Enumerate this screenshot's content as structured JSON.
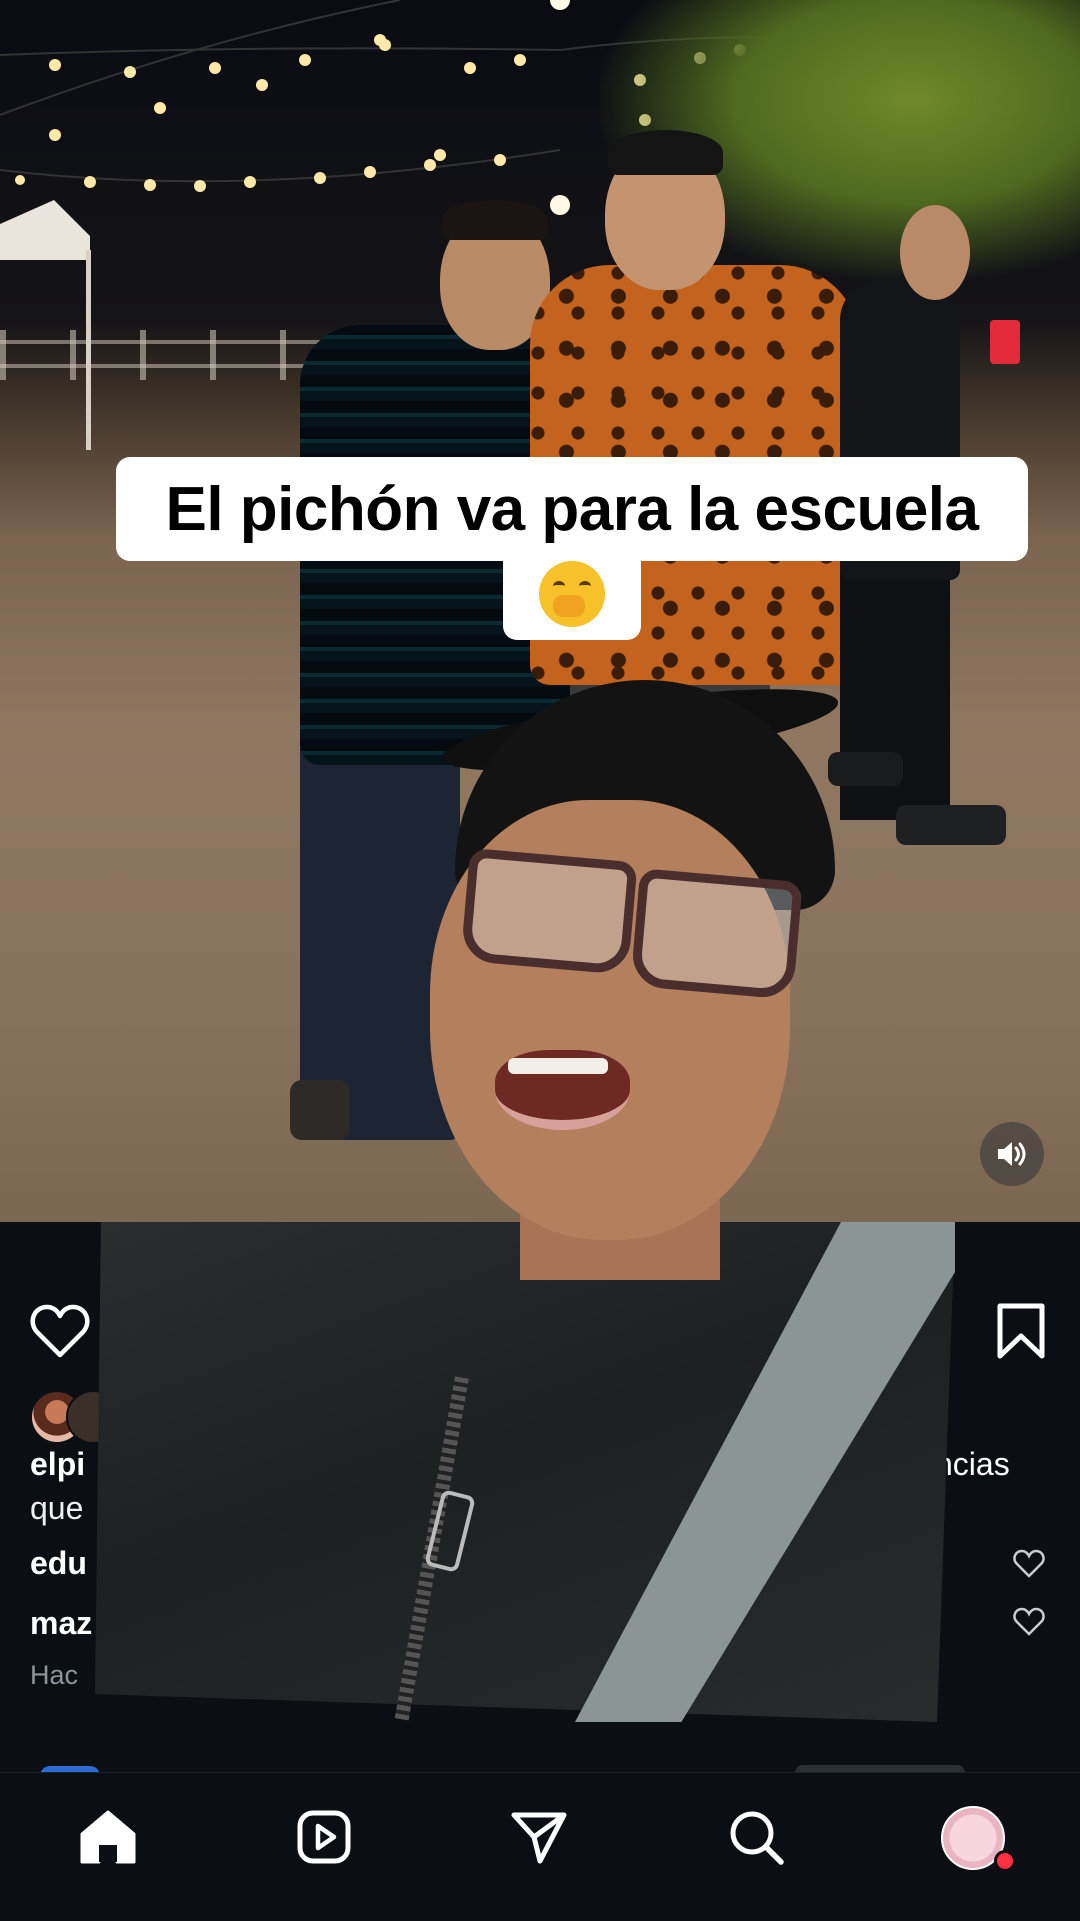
{
  "video": {
    "caption": "El pichón va para la escuela",
    "caption_emoji": "🤭",
    "volume_icon": "speaker-on-icon"
  },
  "post": {
    "username_partial": "elpi",
    "caption_line2_partial": "que",
    "caption_right_partial": "ncias",
    "comments": [
      {
        "user_partial": "edu"
      },
      {
        "user_partial": "maz"
      }
    ],
    "time_partial": "Hac"
  },
  "nav": {
    "items": [
      "home-icon",
      "reels-icon",
      "direct-message-icon",
      "search-icon",
      "profile-avatar"
    ]
  },
  "colors": {
    "background": "#0b0f14",
    "notification": "#ff3040",
    "caption_bg": "#ffffff"
  }
}
